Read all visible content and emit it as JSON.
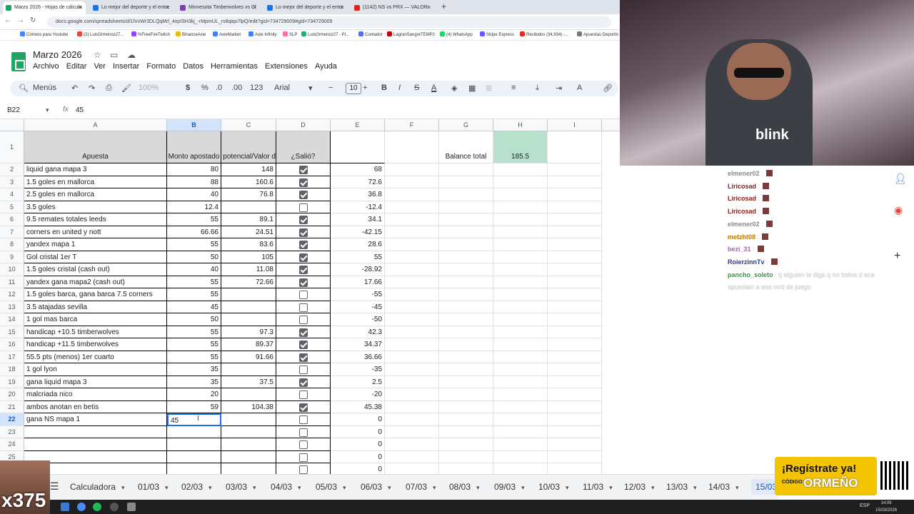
{
  "browser": {
    "tabs": [
      {
        "label": "Marzo 2026 - Hojas de cálculo",
        "color": "#1fa463",
        "active": true
      },
      {
        "label": "Lo mejor del deporte y el entre",
        "color": "#1a73e8"
      },
      {
        "label": "Minnesota Timberwolves vs Cl",
        "color": "#7b3fb5"
      },
      {
        "label": "Lo mejor del deporte y el entre",
        "color": "#1a73e8"
      },
      {
        "label": "(1142) NS vs PRX — VALOR",
        "color": "#e62117"
      }
    ],
    "url": "docs.google.com/spreadsheets/d/1lVvWr3DLQqMrl_4xpISH3kj_-rMpmUL_rs8qiqo7lpQ/edit?gid=734729009#gid=734729009",
    "bookmarks": [
      "Correos para Youtube",
      "(2) LuisOrmenoz27...",
      "%FreeFireTwitch",
      "BinanceAxie",
      "AxieMarket",
      "Axie Infinity",
      "SLP",
      "LuisOrmenoz27 - Pl...",
      "Contador",
      "LagranSangreTEMP2",
      "(4) WhatsApp",
      "Stripe Express",
      "Recibidos (34,934) -...",
      "Apuestas Deportiv"
    ]
  },
  "sheet": {
    "title": "Marzo 2026",
    "menu": [
      "Archivo",
      "Editar",
      "Ver",
      "Insertar",
      "Formato",
      "Datos",
      "Herramientas",
      "Extensiones",
      "Ayuda"
    ],
    "toolbar": {
      "search": "Menús",
      "zoom": "100%",
      "currency": "$",
      "percent": "%",
      "dec_less": ".0",
      "dec_more": ".00",
      "numfmt": "123",
      "font": "Arial",
      "font_size": "10"
    },
    "namebox": "B22",
    "formula": "45",
    "columns": [
      "A",
      "B",
      "C",
      "D",
      "E",
      "F",
      "G",
      "H",
      "I"
    ],
    "header_row": {
      "a": "Apuesta",
      "b": "Monto apostado",
      "c": "Ganancia potencial/Valor de cashout",
      "d": "¿Salió?"
    },
    "balance_label": "Balance total",
    "balance_value": "185.5",
    "active_cell_input": "45",
    "rows": [
      {
        "n": "2",
        "a": "liquid gana mapa 3",
        "b": "80",
        "c": "148",
        "d": true,
        "e": "68"
      },
      {
        "n": "3",
        "a": "1.5 goles en mallorca",
        "b": "88",
        "c": "160.6",
        "d": true,
        "e": "72.6"
      },
      {
        "n": "4",
        "a": "2.5 goles en mallorca",
        "b": "40",
        "c": "76.8",
        "d": true,
        "e": "36.8"
      },
      {
        "n": "5",
        "a": "3.5 goles",
        "b": "12.4",
        "c": "",
        "d": false,
        "e": "-12.4"
      },
      {
        "n": "6",
        "a": "9.5 remates totales leeds",
        "b": "55",
        "c": "89.1",
        "d": true,
        "e": "34.1"
      },
      {
        "n": "7",
        "a": "corners en united y nott",
        "b": "66.66",
        "c": "24.51",
        "d": true,
        "e": "-42.15"
      },
      {
        "n": "8",
        "a": "yandex mapa 1",
        "b": "55",
        "c": "83.6",
        "d": true,
        "e": "28.6"
      },
      {
        "n": "9",
        "a": "Gol cristal 1er T",
        "b": "50",
        "c": "105",
        "d": true,
        "e": "55"
      },
      {
        "n": "10",
        "a": "1.5 goles cristal (cash out)",
        "b": "40",
        "c": "11.08",
        "d": true,
        "e": "-28.92"
      },
      {
        "n": "11",
        "a": "yandex gana mapa2 (cash out)",
        "b": "55",
        "c": "72.66",
        "d": true,
        "e": "17.66"
      },
      {
        "n": "12",
        "a": "1.5 goles barca, gana barca 7.5 corners",
        "b": "55",
        "c": "",
        "d": false,
        "e": "-55"
      },
      {
        "n": "13",
        "a": "3.5 atajadas sevilla",
        "b": "45",
        "c": "",
        "d": false,
        "e": "-45"
      },
      {
        "n": "14",
        "a": "1 gol mas barca",
        "b": "50",
        "c": "",
        "d": false,
        "e": "-50"
      },
      {
        "n": "15",
        "a": "handicap +10.5 timberwolves",
        "b": "55",
        "c": "97.3",
        "d": true,
        "e": "42.3"
      },
      {
        "n": "16",
        "a": "handicap +11.5 timberwolves",
        "b": "55",
        "c": "89.37",
        "d": true,
        "e": "34.37"
      },
      {
        "n": "17",
        "a": "55.5 pts (menos) 1er cuarto",
        "b": "55",
        "c": "91.66",
        "d": true,
        "e": "36.66"
      },
      {
        "n": "18",
        "a": "1 gol lyon",
        "b": "35",
        "c": "",
        "d": false,
        "e": "-35"
      },
      {
        "n": "19",
        "a": "gana liquid mapa 3",
        "b": "35",
        "c": "37.5",
        "d": true,
        "e": "2.5"
      },
      {
        "n": "20",
        "a": "malcriada nico",
        "b": "20",
        "c": "",
        "d": false,
        "e": "-20"
      },
      {
        "n": "21",
        "a": "ambos anotan en betis",
        "b": "59",
        "c": "104.38",
        "d": true,
        "e": "45.38"
      },
      {
        "n": "22",
        "a": "gana NS mapa 1",
        "b": "",
        "c": "",
        "d": false,
        "e": "0"
      },
      {
        "n": "23",
        "a": "",
        "b": "",
        "c": "",
        "d": false,
        "e": "0"
      },
      {
        "n": "24",
        "a": "",
        "b": "",
        "c": "",
        "d": false,
        "e": "0"
      },
      {
        "n": "25",
        "a": "",
        "b": "",
        "c": "",
        "d": false,
        "e": "0"
      },
      {
        "n": "",
        "a": "",
        "b": "",
        "c": "",
        "d": false,
        "e": "0"
      }
    ],
    "sheet_tabs": [
      "Calculadora",
      "01/03",
      "02/03",
      "03/03",
      "04/03",
      "05/03",
      "06/03",
      "07/03",
      "08/03",
      "09/03",
      "10/03",
      "11/03",
      "12/03",
      "13/03",
      "14/03",
      "15/03"
    ],
    "active_tab": "15/03"
  },
  "stream": {
    "chat": [
      {
        "user": "elmener02",
        "msg": ":",
        "color": "#8a8a8a"
      },
      {
        "user": "Liricosad",
        "msg": ":",
        "color": "#8b1a1a"
      },
      {
        "user": "Liricosad",
        "msg": ":",
        "color": "#8b1a1a"
      },
      {
        "user": "Liricosad",
        "msg": ":",
        "color": "#8b1a1a"
      },
      {
        "user": "elmener02",
        "msg": ":",
        "color": "#8a8a8a"
      },
      {
        "user": "metzht08",
        "msg": ":",
        "color": "#c07a00"
      },
      {
        "user": "bezi_31",
        "msg": ":",
        "color": "#b05fb5"
      },
      {
        "user": "RoierzinnTv",
        "msg": ":",
        "color": "#2a3b8a"
      },
      {
        "user": "pancho_soleto",
        "msg": ": q alguien le diga q no todos d aca",
        "color": "#2e9a4a"
      },
      {
        "user": "",
        "msg": "apuestan a esa mrd de juego",
        "color": "#2e9a4a"
      }
    ],
    "promo_line1": "¡Regístrate ya!",
    "promo_code_label": "CÓDIGO:",
    "promo_code": "ORMEÑO",
    "multiplier": "x375",
    "blink_text": "blink",
    "clock_time": "14:09",
    "clock_date": "15/03/2026",
    "lang": "ESP"
  }
}
